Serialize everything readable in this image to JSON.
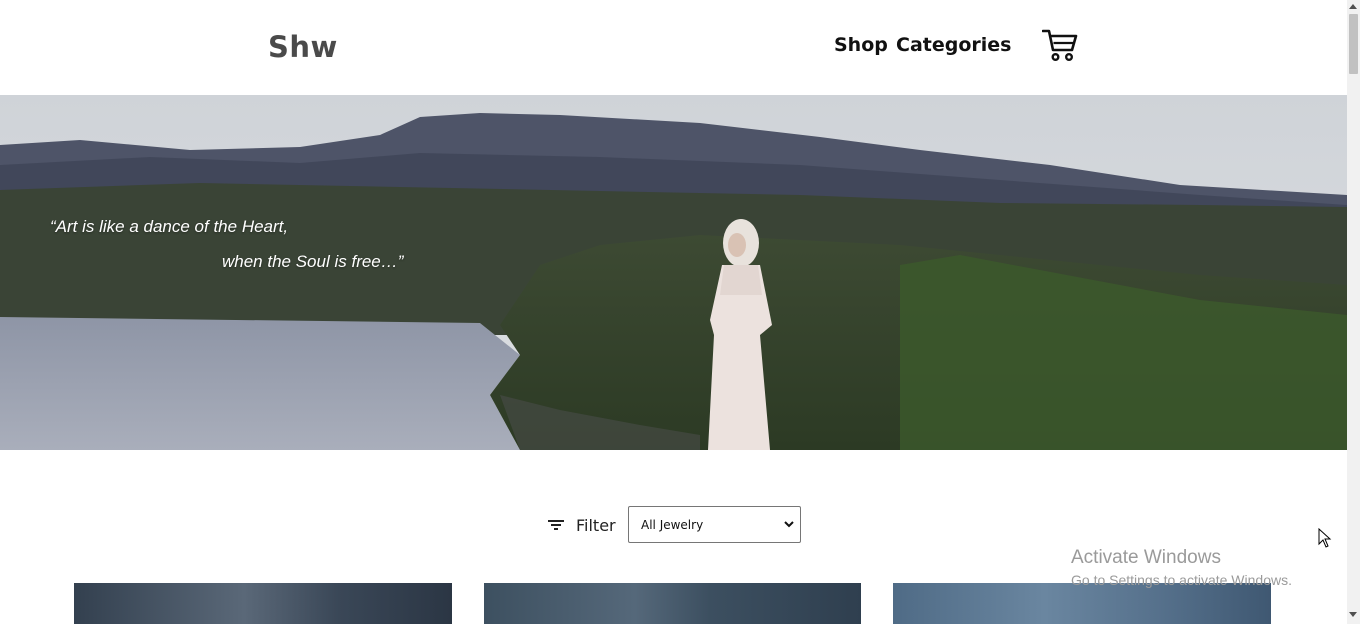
{
  "header": {
    "logo": "Shw",
    "nav": [
      {
        "label": "Shop"
      },
      {
        "label": "Categories"
      }
    ],
    "cart_icon": "cart-icon"
  },
  "hero": {
    "quote_line1": "“Art is like a dance of the Heart,",
    "quote_line2": "when the Soul is free…”"
  },
  "filter": {
    "label": "Filter",
    "icon": "filter-icon",
    "select_value": "All Jewelry"
  },
  "products": [
    {
      "name": "product-card-1"
    },
    {
      "name": "product-card-2"
    },
    {
      "name": "product-card-3"
    }
  ],
  "watermark": {
    "title": "Activate Windows",
    "subtitle": "Go to Settings to activate Windows."
  },
  "colors": {
    "logo": "#4a4a4a",
    "text": "#111111",
    "watermark": "#9a9a9a"
  }
}
